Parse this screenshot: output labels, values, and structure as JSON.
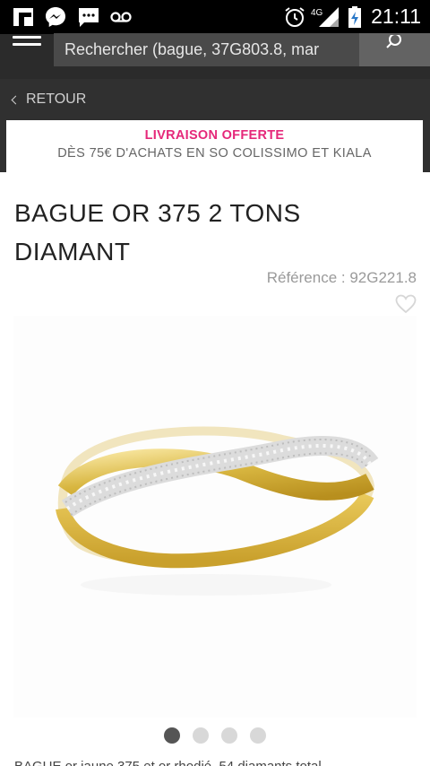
{
  "status_bar": {
    "time": "21:11",
    "network": "4G",
    "icons": [
      "flipboard-icon",
      "messenger-icon",
      "sms-icon",
      "voicemail-icon",
      "alarm-icon",
      "signal-icon",
      "battery-charging-icon"
    ]
  },
  "search": {
    "value": "Rechercher (bague, 37G803.8, mar"
  },
  "nav": {
    "back_label": "RETOUR"
  },
  "banner": {
    "title": "LIVRAISON OFFERTE",
    "subtitle": "DÈS 75€ D'ACHATS EN SO COLISSIMO ET KIALA"
  },
  "product": {
    "title_line1": "BAGUE OR 375 2 TONS",
    "title_line2": "DIAMANT",
    "reference": "Référence : 92G221.8",
    "description_partial": "BAGUE or jaune 375 et or rhodié, 54 diamants total"
  },
  "carousel": {
    "count": 4,
    "active_index": 0
  },
  "colors": {
    "accent_pink": "#e5287a",
    "dark_bar": "#2b2b2b",
    "search_bg": "#4a4a4a",
    "gold": "#d8b640"
  }
}
